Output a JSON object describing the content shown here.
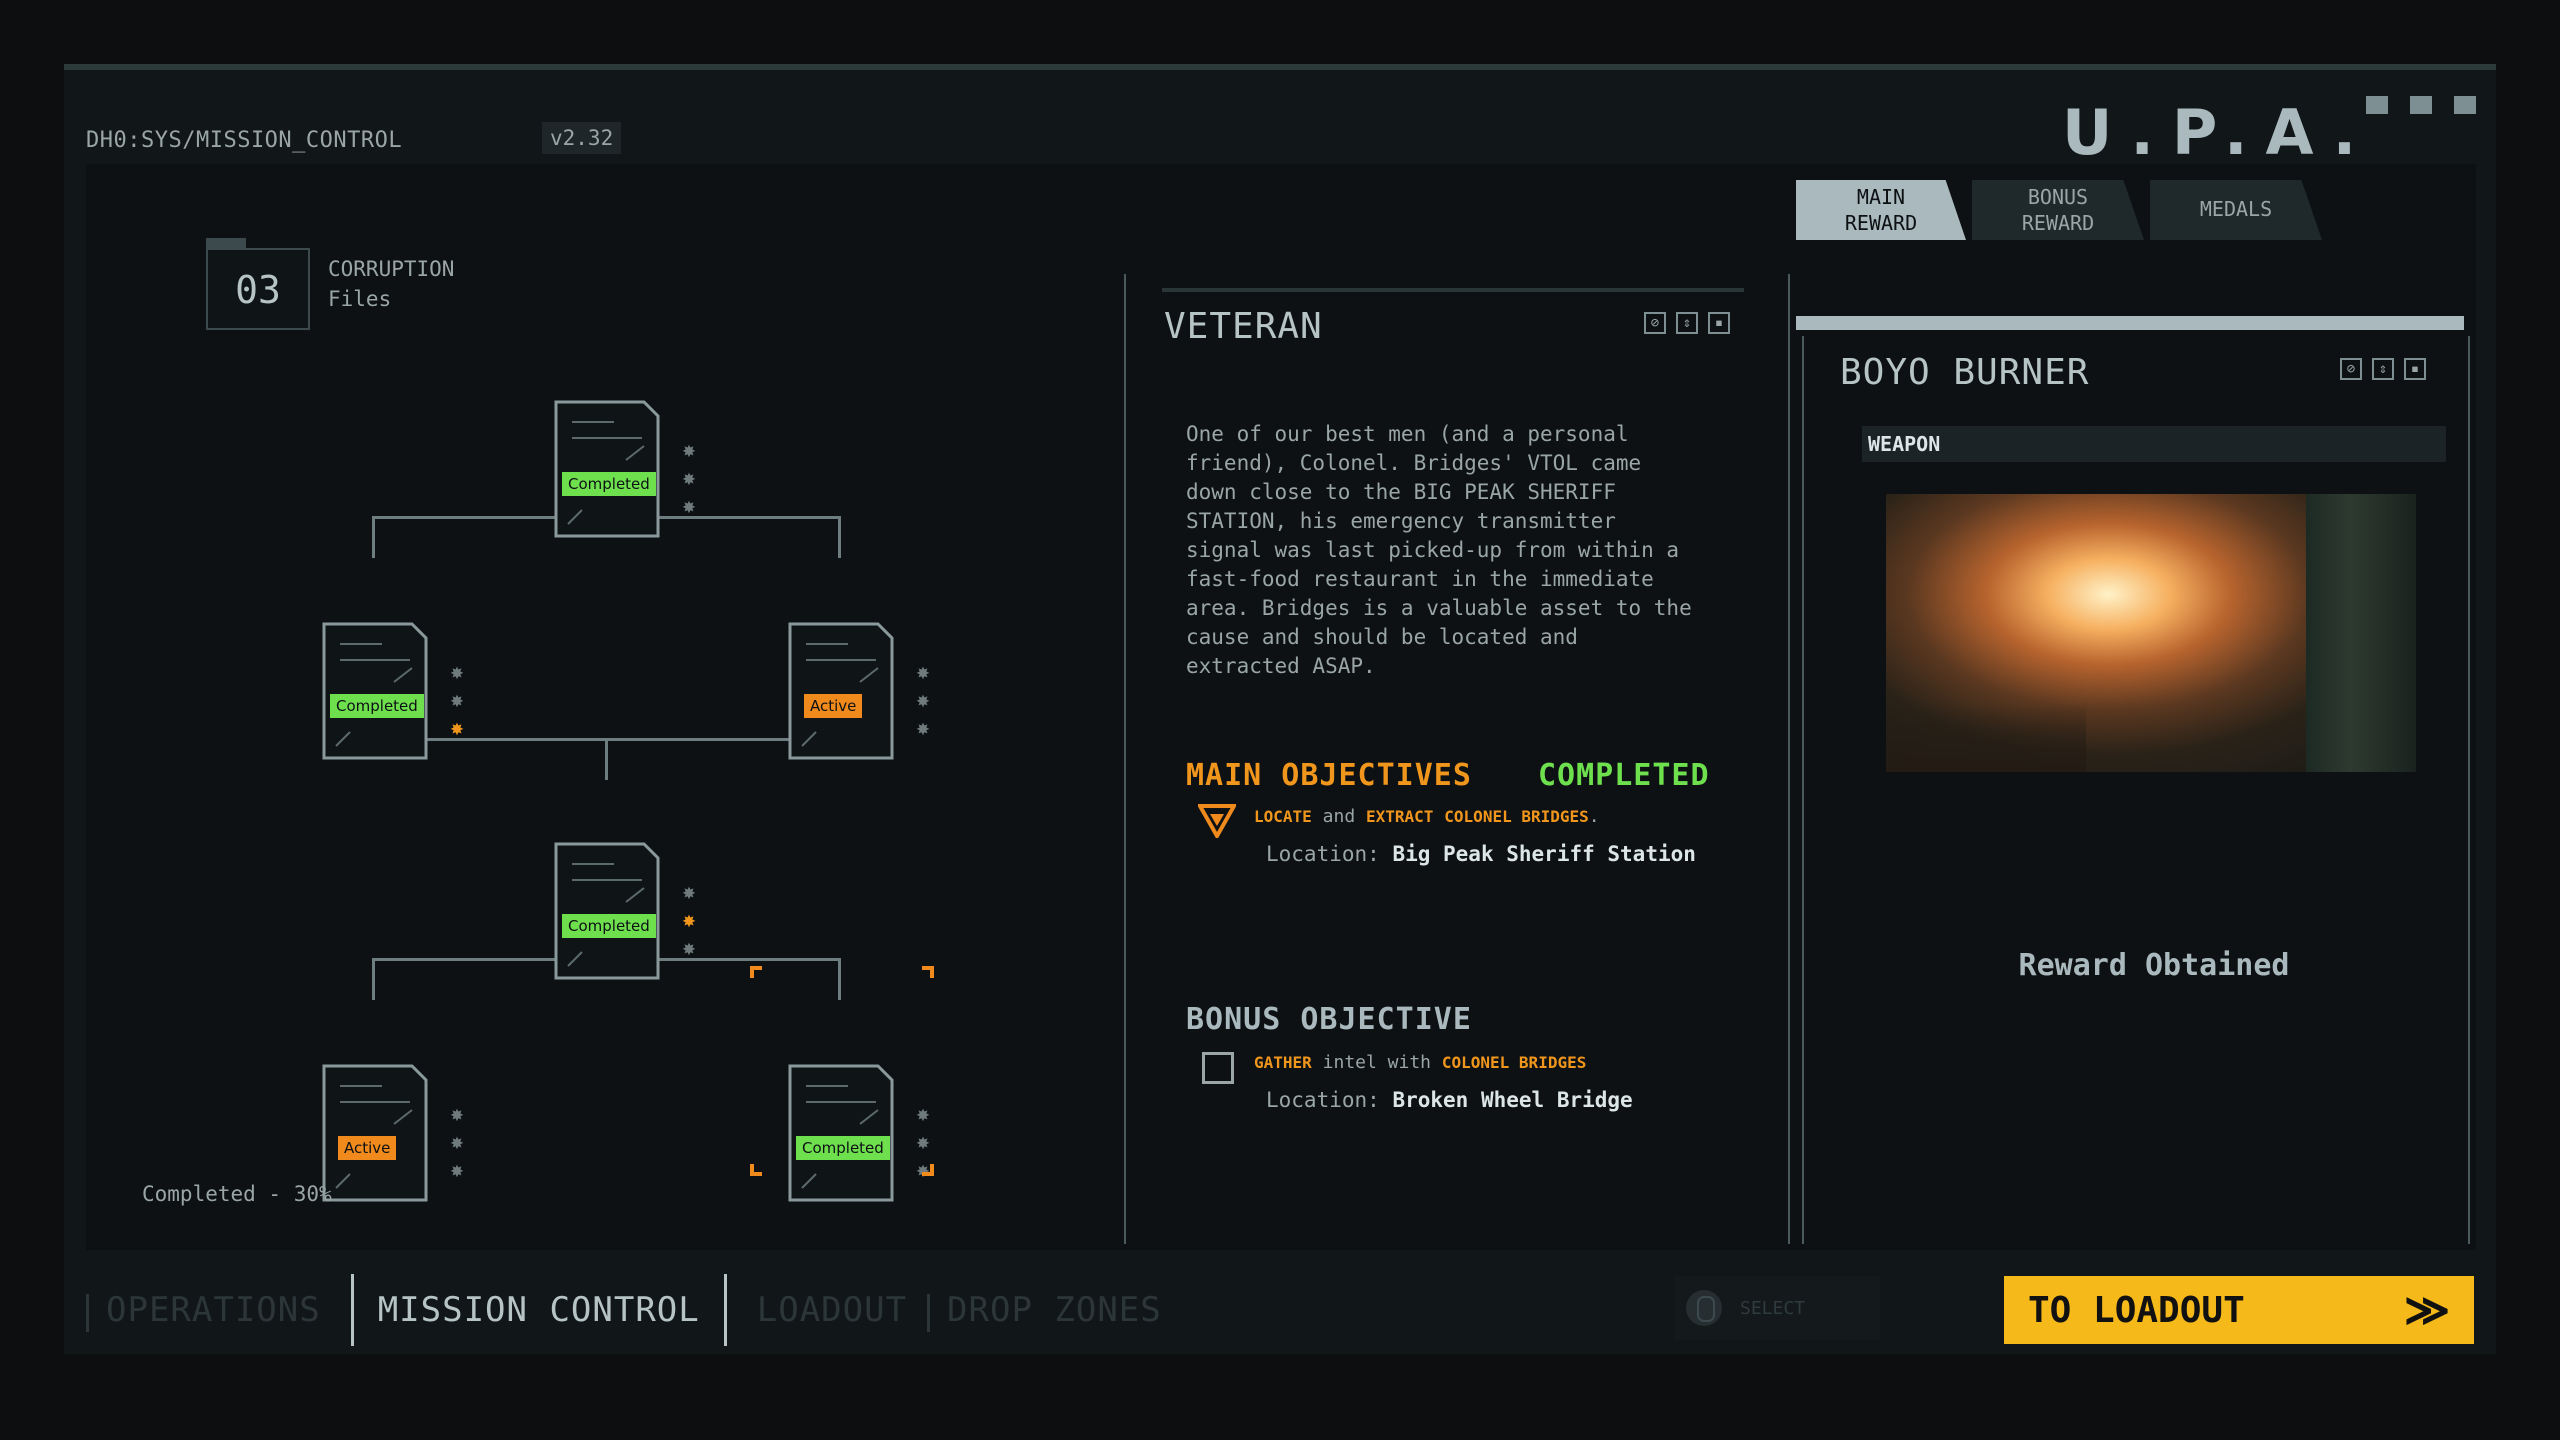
{
  "header": {
    "path": "DH0:SYS/MISSION_CONTROL",
    "version": "v2.32",
    "logo": "U.P.A."
  },
  "files": {
    "number": "03",
    "title_line1": "CORRUPTION",
    "title_line2": "Files",
    "progress": "Completed - 30%"
  },
  "tree": {
    "nodes": [
      {
        "status": "Completed",
        "medals_earned": 0
      },
      {
        "status": "Completed",
        "medals_earned": 1
      },
      {
        "status": "Active",
        "medals_earned": 0
      },
      {
        "status": "Completed",
        "medals_earned": 1
      },
      {
        "status": "Active",
        "medals_earned": 0
      },
      {
        "status": "Completed",
        "medals_earned": 0
      }
    ]
  },
  "mission": {
    "title": "VETERAN",
    "description": "One of our best men (and a personal\nfriend), Colonel. Bridges' VTOL came\ndown close to the BIG PEAK SHERIFF\nSTATION, his emergency transmitter\nsignal was last picked-up from within a\nfast-food restaurant in the immediate\narea. Bridges is a valuable asset to the\ncause and should be located and\nextracted ASAP.",
    "main_objectives_label": "MAIN OBJECTIVES",
    "main_status": "COMPLETED",
    "main_obj": {
      "verb1": "LOCATE",
      "and": "and",
      "verb2": "EXTRACT",
      "target": "COLONEL BRIDGES",
      "end": ".",
      "location_label": "Location:",
      "location": "Big Peak Sheriff Station"
    },
    "bonus_objective_label": "BONUS OBJECTIVE",
    "bonus_obj": {
      "verb": "GATHER",
      "mid": "intel with",
      "target": "COLONEL BRIDGES",
      "location_label": "Location:",
      "location": "Broken Wheel Bridge"
    }
  },
  "reward": {
    "tabs": [
      {
        "line1": "MAIN",
        "line2": "REWARD"
      },
      {
        "line1": "BONUS",
        "line2": "REWARD"
      },
      {
        "line1": "MEDALS",
        "line2": ""
      }
    ],
    "name": "BOYO BURNER",
    "category": "WEAPON",
    "status": "Reward Obtained"
  },
  "nav": {
    "items": [
      "OPERATIONS",
      "MISSION CONTROL",
      "LOADOUT",
      "DROP ZONES"
    ],
    "select_hint": "SELECT",
    "cta": "TO LOADOUT",
    "cta_icon": "double-chevron-right-icon"
  },
  "colors": {
    "accent": "#f6b91a",
    "completed": "#6ee04e",
    "active": "#f08a1c"
  }
}
